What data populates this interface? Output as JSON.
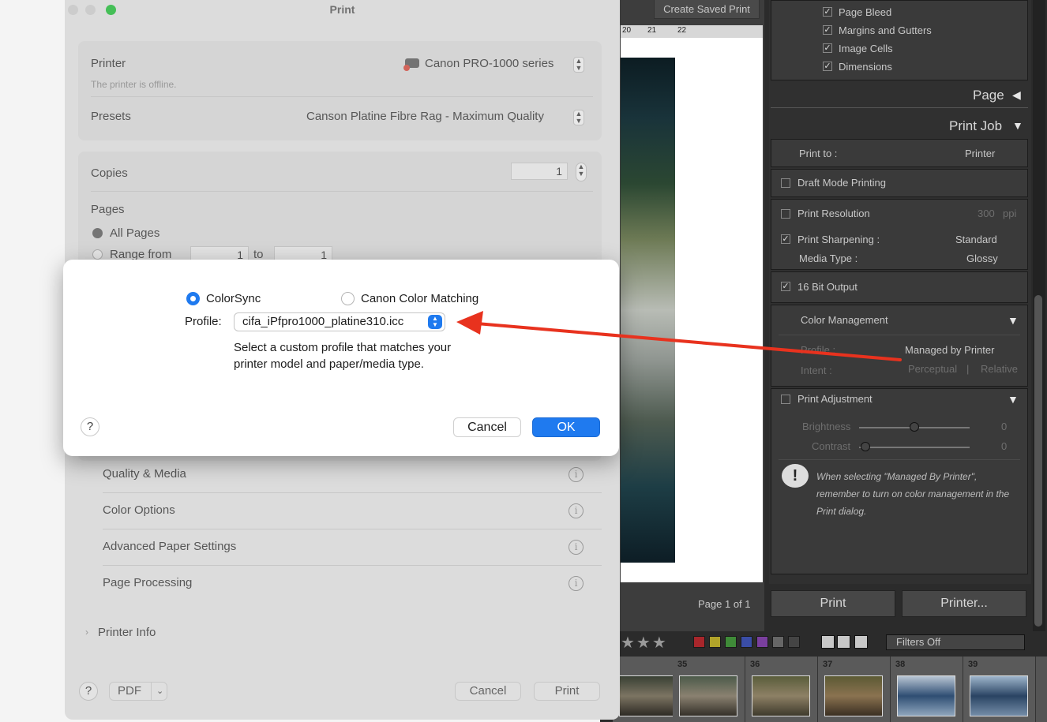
{
  "lightroom": {
    "toolbar": {
      "create_saved_print": "Create Saved Print"
    },
    "ruler": [
      "20",
      "21",
      "22"
    ],
    "page_info": "Page 1 of 1",
    "guides": [
      "Page Bleed",
      "Margins and Gutters",
      "Image Cells",
      "Dimensions"
    ],
    "page_panel": "Page",
    "print_job": {
      "title": "Print Job",
      "print_to_label": "Print to :",
      "print_to_value": "Printer",
      "draft_mode": "Draft Mode Printing",
      "print_resolution": "Print Resolution",
      "resolution_value": "300",
      "resolution_unit": "ppi",
      "print_sharpening": "Print Sharpening :",
      "sharpening_value": "Standard",
      "media_type": "Media Type :",
      "media_value": "Glossy",
      "bit_output": "16 Bit Output",
      "color_management": "Color Management",
      "profile_label": "Profile :",
      "profile_value": "Managed by Printer",
      "intent_label": "Intent :",
      "intent_perceptual": "Perceptual",
      "intent_sep": "|",
      "intent_relative": "Relative",
      "print_adjustment": "Print Adjustment",
      "brightness": "Brightness",
      "brightness_value": "0",
      "contrast": "Contrast",
      "contrast_value": "0",
      "note": "When selecting \"Managed By Printer\", remember to turn on color management in the Print dialog.",
      "print_button": "Print",
      "printer_button": "Printer..."
    },
    "filmstrip": {
      "stars": "★★★",
      "filters": "Filters Off",
      "cells": [
        "35",
        "36",
        "37",
        "38",
        "39"
      ],
      "colors": [
        "#a8262b",
        "#b1a32a",
        "#3f8b38",
        "#3a4da6",
        "#7a3f9e"
      ]
    }
  },
  "print_dialog": {
    "title": "Print",
    "printer_label": "Printer",
    "printer_value": "Canon PRO-1000 series",
    "printer_status": "The printer is offline.",
    "presets_label": "Presets",
    "presets_value": "Canson Platine Fibre Rag - Maximum Quality",
    "copies_label": "Copies",
    "copies_value": "1",
    "pages_label": "Pages",
    "all_pages": "All Pages",
    "range_from": "Range from",
    "range_start": "1",
    "range_to": "to",
    "range_end": "1",
    "sections": [
      "Quality & Media",
      "Color Options",
      "Advanced Paper Settings",
      "Page Processing"
    ],
    "printer_info": "Printer Info",
    "pdf_label": "PDF",
    "cancel": "Cancel",
    "print": "Print",
    "help": "?"
  },
  "modal": {
    "option_colorsync": "ColorSync",
    "option_canon": "Canon Color Matching",
    "profile_label": "Profile:",
    "profile_value": "cifa_iPfpro1000_platine310.icc",
    "description_line1": "Select a custom profile that matches your",
    "description_line2": "printer model and paper/media type.",
    "help": "?",
    "cancel": "Cancel",
    "ok": "OK",
    "accent": "#1f7aef"
  },
  "annotation": {
    "arrow_color": "#e8321e"
  }
}
